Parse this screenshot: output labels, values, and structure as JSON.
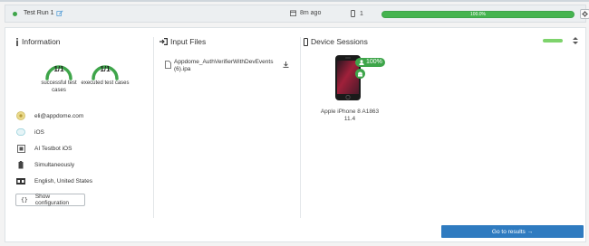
{
  "header": {
    "run_name": "Test Run 1",
    "elapsed": "8m ago",
    "device_count": "1",
    "progress_label": "100.0%",
    "progress_value": 1.0,
    "status_color": "#3ea54a"
  },
  "information": {
    "title": "Information",
    "gauges": [
      {
        "value": "1/1",
        "caption": "successful test cases",
        "fraction": 1.0
      },
      {
        "value": "1/1",
        "caption": "executed test cases",
        "fraction": 1.0
      }
    ],
    "rows": [
      {
        "icon": "user-avatar-icon",
        "text": "eli@appdome.com"
      },
      {
        "icon": "os-icon",
        "text": "iOS"
      },
      {
        "icon": "testbot-icon",
        "text": "AI Testbot iOS"
      },
      {
        "icon": "battery-icon",
        "text": "Simultaneously"
      },
      {
        "icon": "language-icon",
        "text": "English, United States"
      }
    ],
    "config_button": "Show configuration"
  },
  "input_files": {
    "title": "Input Files",
    "file_name": "Appdome_AuthVerifierWithDevEvents (6).ipa"
  },
  "device_sessions": {
    "title": "Device Sessions",
    "pass_percent": "100%",
    "device_name": "Apple iPhone 8 A1863",
    "device_os": "11.4"
  },
  "footer": {
    "results_button": "Go to results →"
  },
  "colors": {
    "accent_green": "#3ea54a",
    "button_blue": "#2f7bc0"
  }
}
